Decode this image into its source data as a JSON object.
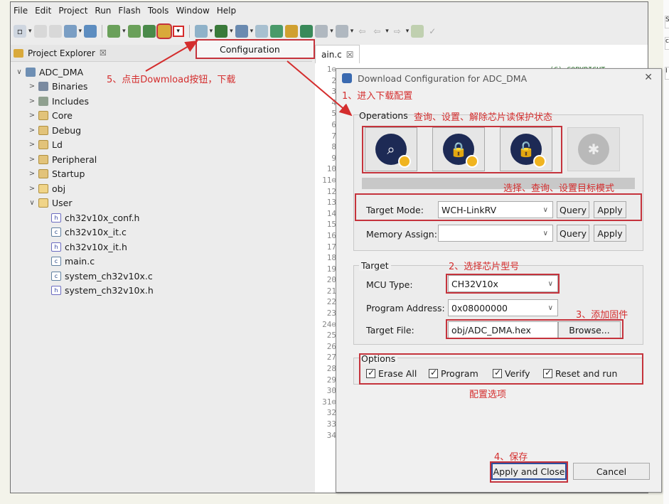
{
  "menu": [
    "File",
    "Edit",
    "Project",
    "Run",
    "Flash",
    "Tools",
    "Window",
    "Help"
  ],
  "toolbar_popup": "Configuration",
  "sidebar": {
    "title": "Project Explorer",
    "tab_close": "☒",
    "items": [
      {
        "label": "ADC_DMA",
        "level": 0,
        "chev": "∨",
        "icon": "proj"
      },
      {
        "label": "Binaries",
        "level": 1,
        "chev": ">",
        "icon": "bin"
      },
      {
        "label": "Includes",
        "level": 1,
        "chev": ">",
        "icon": "inc"
      },
      {
        "label": "Core",
        "level": 1,
        "chev": ">",
        "icon": "fold"
      },
      {
        "label": "Debug",
        "level": 1,
        "chev": ">",
        "icon": "fold"
      },
      {
        "label": "Ld",
        "level": 1,
        "chev": ">",
        "icon": "fold"
      },
      {
        "label": "Peripheral",
        "level": 1,
        "chev": ">",
        "icon": "fold"
      },
      {
        "label": "Startup",
        "level": 1,
        "chev": ">",
        "icon": "fold"
      },
      {
        "label": "obj",
        "level": 1,
        "chev": ">",
        "icon": "foldopen"
      },
      {
        "label": "User",
        "level": 1,
        "chev": "∨",
        "icon": "foldopen"
      },
      {
        "label": "ch32v10x_conf.h",
        "level": 2,
        "chev": "",
        "icon": "h"
      },
      {
        "label": "ch32v10x_it.c",
        "level": 2,
        "chev": "",
        "icon": "c"
      },
      {
        "label": "ch32v10x_it.h",
        "level": 2,
        "chev": "",
        "icon": "h"
      },
      {
        "label": "main.c",
        "level": 2,
        "chev": "",
        "icon": "c"
      },
      {
        "label": "system_ch32v10x.c",
        "level": 2,
        "chev": "",
        "icon": "c"
      },
      {
        "label": "system_ch32v10x.h",
        "level": 2,
        "chev": "",
        "icon": "h"
      }
    ]
  },
  "editor": {
    "tab_label": "ain.c",
    "tab_close": "☒",
    "comment_fragment": "(C) COPYRIGHT",
    "line_numbers": [
      "1⊖",
      "2",
      "3",
      "4",
      "5",
      "6",
      "7",
      "8",
      "9",
      "10",
      "11⊖",
      "12",
      "13",
      "14",
      "15",
      "16",
      "17",
      "18",
      "19",
      "20",
      "21",
      "22",
      "23",
      "24⊖",
      "25",
      "26",
      "27",
      "28",
      "29",
      "30",
      "31⊖",
      "32",
      "33",
      "34"
    ]
  },
  "dialog": {
    "title": "Download Configuration for ADC_DMA",
    "close": "✕",
    "operations_label": "Operations",
    "target_mode_label": "Target Mode:",
    "target_mode_value": "WCH-LinkRV",
    "memory_assign_label": "Memory Assign:",
    "memory_assign_value": "",
    "query": "Query",
    "apply": "Apply",
    "target_group": "Target",
    "mcu_type_label": "MCU Type:",
    "mcu_type_value": "CH32V10x",
    "program_address_label": "Program Address:",
    "program_address_value": "0x08000000",
    "target_file_label": "Target File:",
    "target_file_value": "obj/ADC_DMA.hex",
    "browse": "Browse...",
    "options_group": "Options",
    "erase_all": "Erase All",
    "program": "Program",
    "verify": "Verify",
    "reset_and_run": "Reset and run",
    "apply_and_close": "Apply and Close",
    "cancel": "Cancel"
  },
  "annotations": {
    "a1": "1、进入下载配置",
    "ops_note": "查询、设置、解除芯片读保护状态",
    "mode_note": "选择、查询、设置目标模式",
    "a2": "2、选择芯片型号",
    "a3": "3、添加固件",
    "opt_note": "配置选项",
    "a4": "4、保存",
    "a5": "5、点击Dowmload按钮，下载"
  },
  "right_strip": [
    "S",
    "c",
    "I"
  ]
}
